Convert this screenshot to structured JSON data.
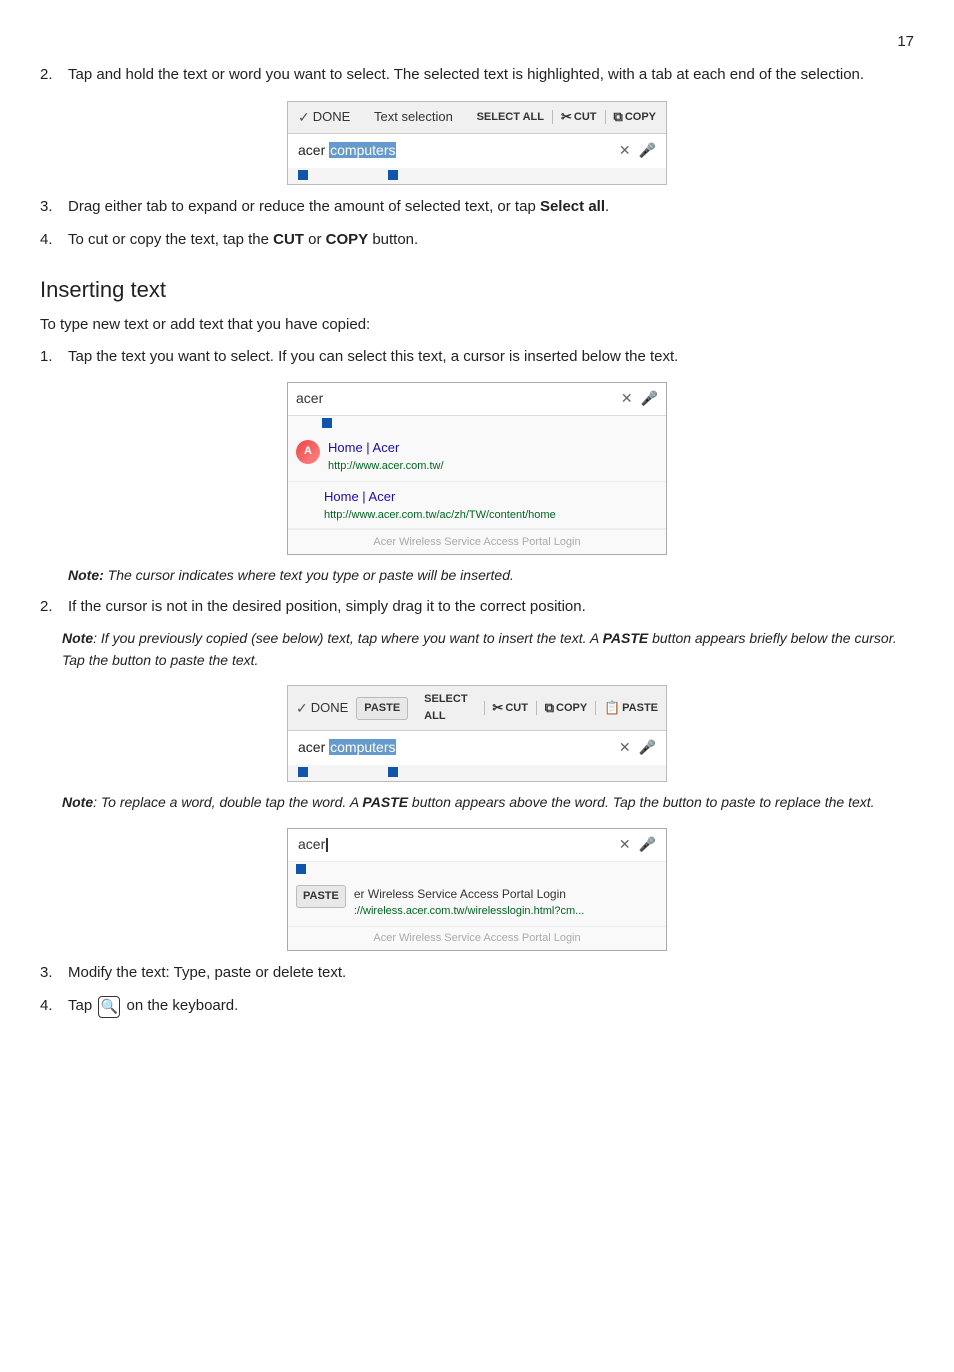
{
  "page": {
    "number": "17",
    "sections": [
      {
        "id": "text-selection",
        "items": [
          {
            "num": "2.",
            "text": "Tap and hold the text or word you want to select. The selected text is highlighted, with a tab at each end of the selection."
          }
        ],
        "toolbar": {
          "done_label": "DONE",
          "text_selection_label": "Text selection",
          "select_all_label": "SELECT ALL",
          "cut_label": "CUT",
          "copy_label": "COPY"
        },
        "input_text": "acer ",
        "input_highlight": "computers",
        "items2": [
          {
            "num": "3.",
            "text": "Drag either tab to expand or reduce the amount of selected text, or tap ",
            "bold": "Select all",
            "text2": "."
          },
          {
            "num": "4.",
            "text": "To cut or copy the text, tap the ",
            "bold1": "CUT",
            "mid": " or ",
            "bold2": "COPY",
            "text2": " button."
          }
        ]
      },
      {
        "id": "inserting-text",
        "heading": "Inserting text",
        "intro": "To type new text or add text that you have copied:",
        "items": [
          {
            "num": "1.",
            "text": "Tap the text you want to select. If you can select this text, a cursor is inserted below the text."
          }
        ],
        "search_panel": {
          "input_text": "acer",
          "results": [
            {
              "type": "icon",
              "title": "Home | Acer",
              "url": "http://www.acer.com.tw/"
            },
            {
              "type": "no-icon",
              "title": "Home | Acer",
              "url": "http://www.acer.com.tw/ac/zh/TW/content/home"
            }
          ],
          "faded": "Acer Wireless Service Access Portal Login"
        },
        "note1": "The cursor indicates where text you type or paste will be inserted.",
        "items2": [
          {
            "num": "2.",
            "text": "If the cursor is not in the desired position, simply drag it to the correct position."
          }
        ],
        "note2": "If you previously copied (see below) text, tap where you want to insert the text. A ",
        "note2_bold": "PASTE",
        "note2_rest": " button appears briefly below the cursor. Tap the button to paste the text.",
        "paste_toolbar": {
          "done_label": "DONE",
          "paste_label": "PASTE",
          "select_all_label": "SELECT ALL",
          "cut_label": "CUT",
          "copy_label": "COPY",
          "paste_label2": "PASTE"
        },
        "paste_input_text": "acer ",
        "paste_highlight": "computers",
        "note3": "To replace a word, double tap the word. A ",
        "note3_bold": "PASTE",
        "note3_rest": " button appears above the word. Tap the button to paste to replace the text.",
        "acer_panel": {
          "input_text": "acer",
          "paste_text": "er Wireless Service Access Portal Login",
          "paste_url": "://wireless.acer.com.tw/wirelesslogin.html?cm...",
          "faded": "Acer Wireless Service Access Portal Login"
        },
        "items3": [
          {
            "num": "3.",
            "text": "Modify the text: Type, paste or delete text."
          },
          {
            "num": "4.",
            "text": " on the keyboard.",
            "has_key": true,
            "key_symbol": "🔍"
          }
        ]
      }
    ]
  }
}
